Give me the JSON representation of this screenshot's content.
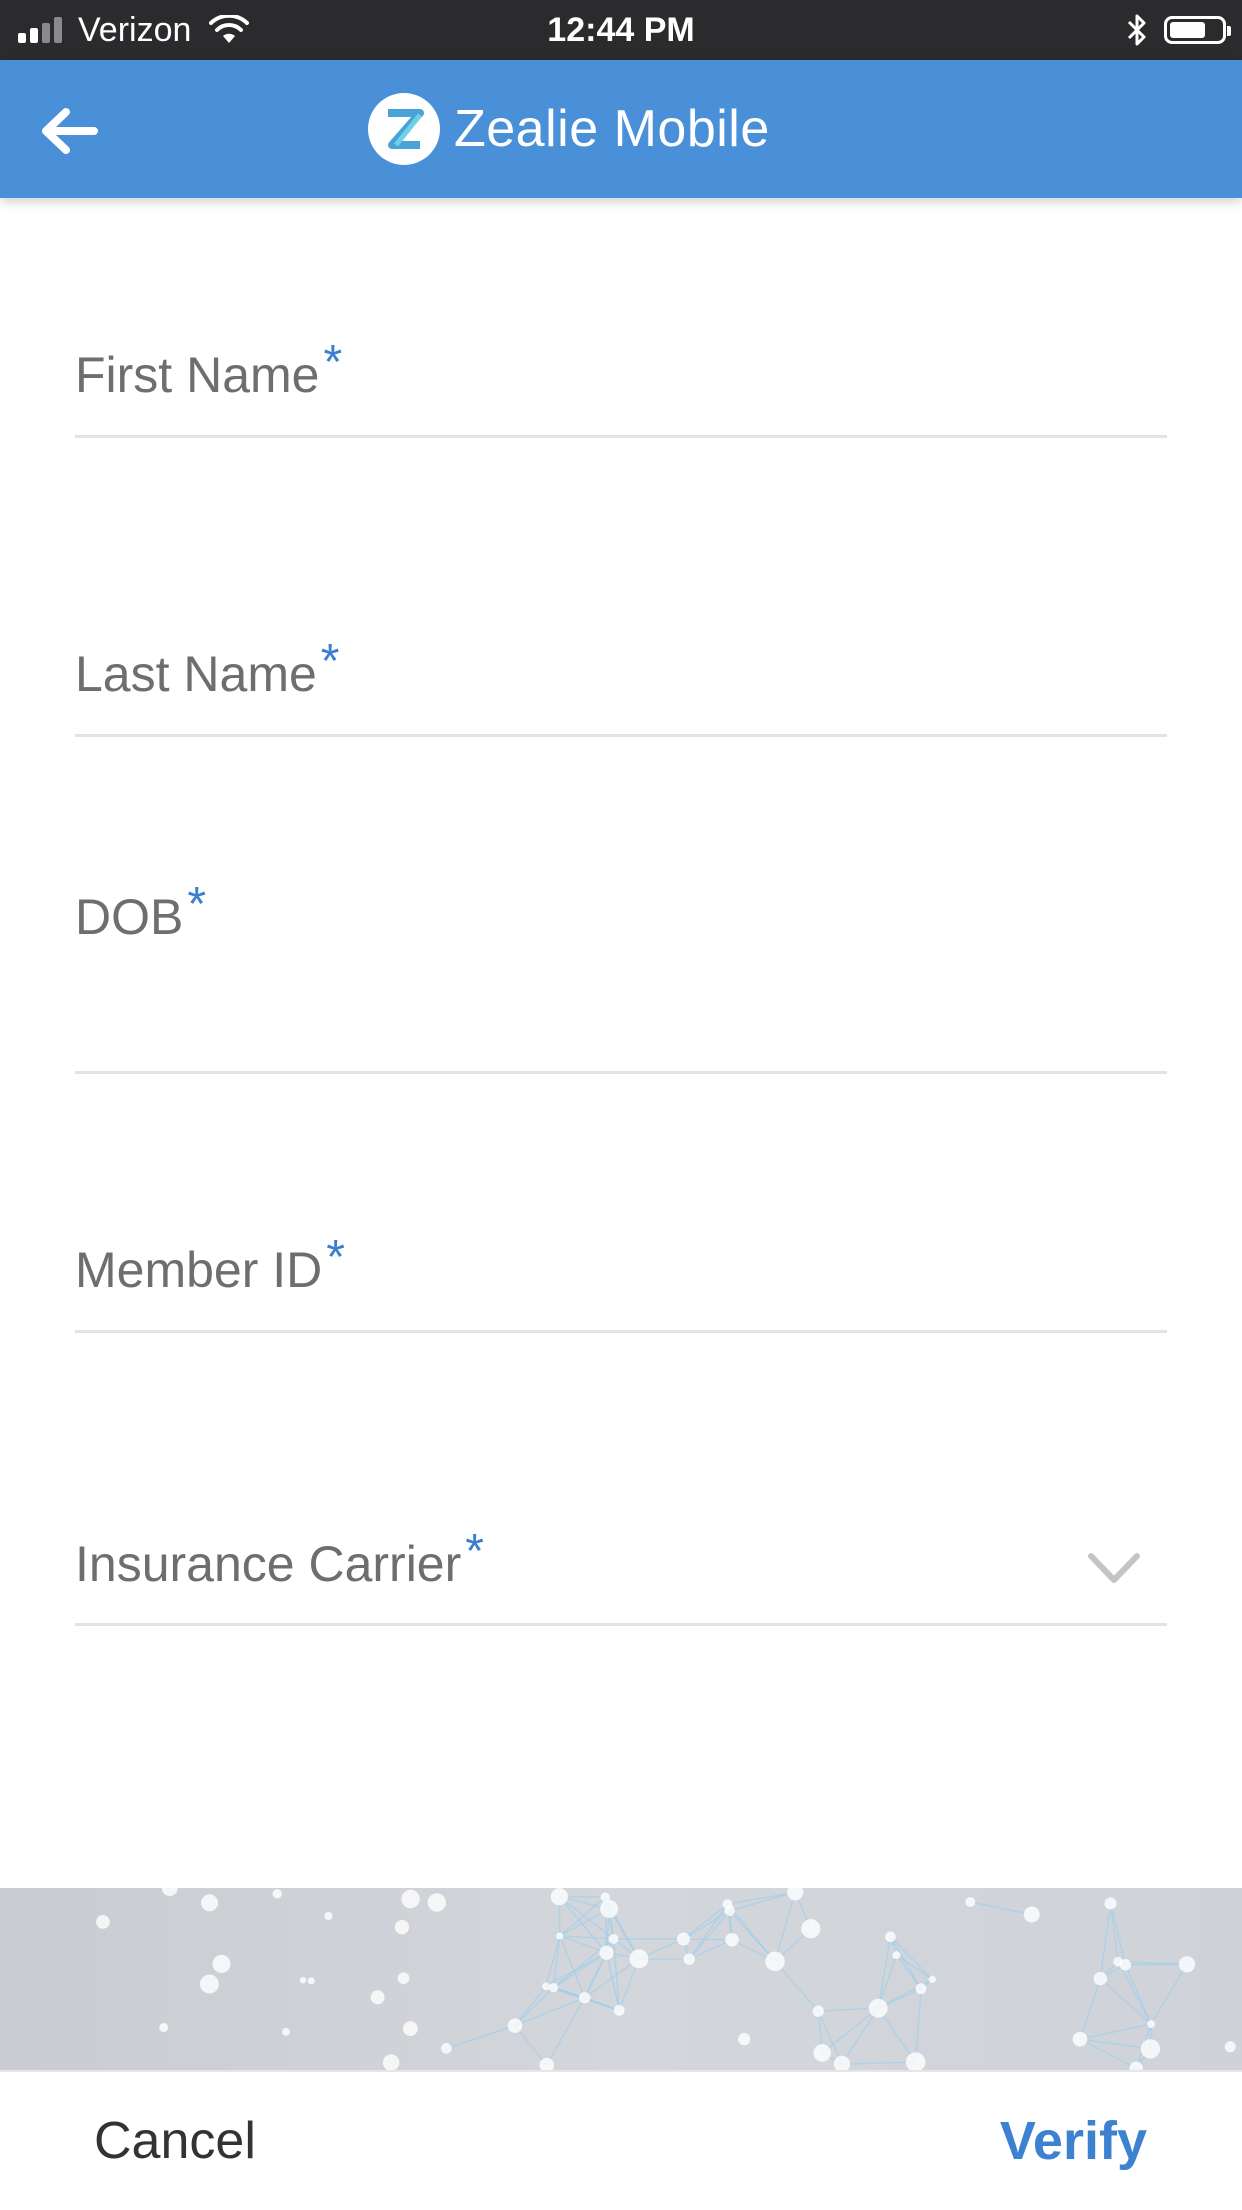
{
  "status_bar": {
    "carrier": "Verizon",
    "time": "12:44 PM",
    "signal_bars_filled": 2,
    "signal_bars_total": 4,
    "battery_level": 0.7,
    "icons": [
      "wifi-icon",
      "bluetooth-icon",
      "battery-icon"
    ]
  },
  "header": {
    "title": "Zealie Mobile",
    "back_icon": "arrow-left-icon",
    "logo_icon": "zealie-z-logo",
    "background_color": "#4a90d9"
  },
  "form": {
    "required_marker": "*",
    "required_color": "#3a7fcf",
    "fields": [
      {
        "label": "First Name",
        "value": "",
        "required": true
      },
      {
        "label": "Last Name",
        "value": "",
        "required": true
      },
      {
        "label": "DOB",
        "value": "",
        "required": true
      },
      {
        "label": "Member ID",
        "value": "",
        "required": true
      },
      {
        "label": "Insurance Carrier",
        "value": "",
        "required": true,
        "type": "select",
        "icon": "chevron-down-icon"
      }
    ]
  },
  "actions": {
    "cancel_label": "Cancel",
    "verify_label": "Verify",
    "verify_color": "#3d82d0"
  }
}
